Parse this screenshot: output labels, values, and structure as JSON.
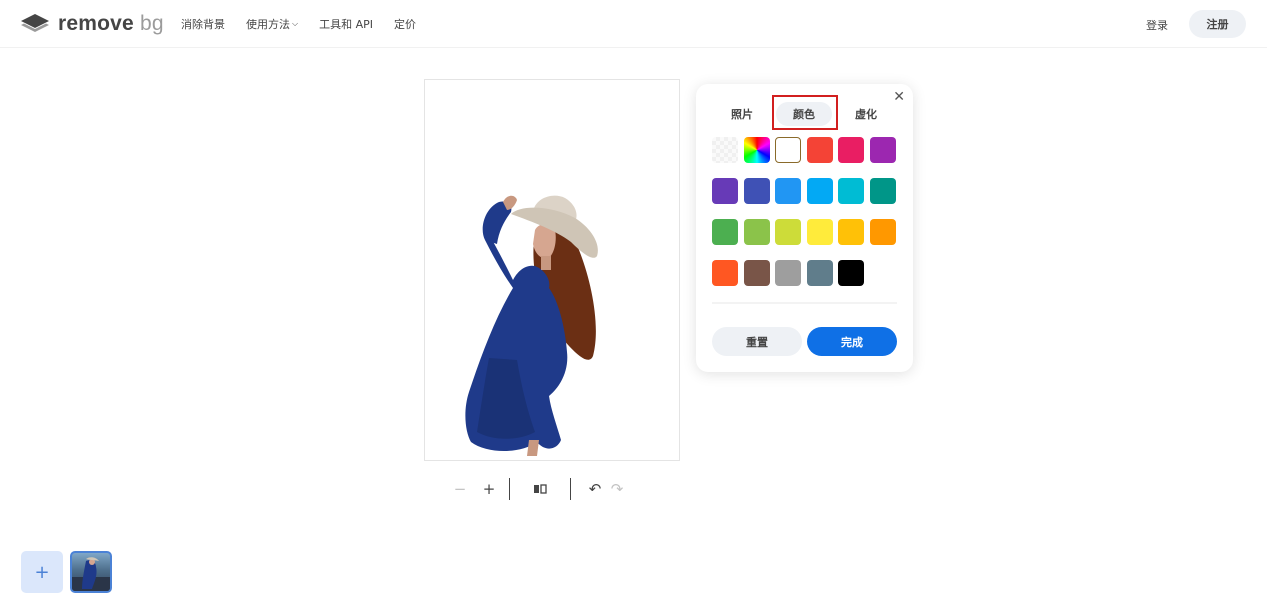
{
  "header": {
    "logo_main": "remove",
    "logo_sub": "bg",
    "nav": [
      {
        "label": "消除背景"
      },
      {
        "label": "使用方法",
        "chevron": "chevron-down-icon"
      },
      {
        "label": "工具和 API"
      },
      {
        "label": "定价"
      }
    ],
    "login_label": "登录",
    "signup_label": "注册"
  },
  "toolbar": {
    "icons": [
      "zoom-out-icon",
      "zoom-in-icon",
      "compare-icon",
      "undo-icon",
      "redo-icon"
    ],
    "redo_disabled": true,
    "zoom_out_disabled": true
  },
  "popup": {
    "tabs": [
      {
        "label": "照片",
        "active": false
      },
      {
        "label": "颜色",
        "active": true
      },
      {
        "label": "虚化",
        "active": false
      }
    ],
    "swatches": [
      "transparent",
      "rainbow",
      "#ffffff",
      "#f44336",
      "#e91e63",
      "#9c27b0",
      "#673ab7",
      "#3f51b5",
      "#2196f3",
      "#03a9f4",
      "#00bcd4",
      "#009688",
      "#4caf50",
      "#8bc34a",
      "#cddc39",
      "#ffeb3b",
      "#ffc107",
      "#ff9800",
      "#ff5722",
      "#795548",
      "#9e9e9e",
      "#607d8b",
      "#000000"
    ],
    "selected_swatch": "#ffffff",
    "reset_label": "重置",
    "done_label": "完成"
  },
  "colors": {
    "accent": "#0f70e6",
    "highlight_border": "#d21f1f",
    "dress": "#1f3a8a"
  }
}
